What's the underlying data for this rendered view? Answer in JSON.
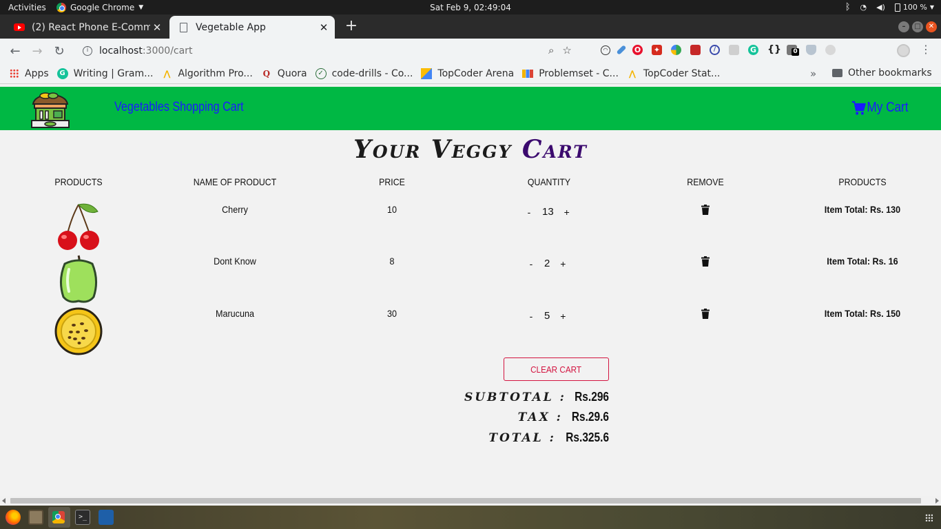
{
  "system_panel": {
    "activities": "Activities",
    "app_name": "Google Chrome",
    "clock": "Sat Feb  9, 02:49:04",
    "battery": "100 %"
  },
  "browser": {
    "tabs": [
      {
        "title": "(2) React Phone E-Comme",
        "icon": "youtube-icon"
      },
      {
        "title": "Vegetable App",
        "icon": "page-icon"
      }
    ],
    "url_host": "localhost",
    "url_path": ":3000/cart",
    "ext_badge": "0",
    "bookmarks": [
      {
        "label": "Apps",
        "icon": "apps-grid-icon"
      },
      {
        "label": "Writing | Gram...",
        "icon": "grammarly-icon"
      },
      {
        "label": "Algorithm Pro...",
        "icon": "algorithm-icon"
      },
      {
        "label": "Quora",
        "icon": "quora-icon"
      },
      {
        "label": "code-drills - Co...",
        "icon": "check-icon"
      },
      {
        "label": "TopCoder Arena",
        "icon": "topcoder-icon"
      },
      {
        "label": "Problemset - C...",
        "icon": "bars-icon"
      },
      {
        "label": "TopCoder Stat...",
        "icon": "topcoder-stat-icon"
      }
    ],
    "more_bookmarks": "»",
    "other_bookmarks": "Other bookmarks"
  },
  "app": {
    "brand": "Vegetables Shopping Cart",
    "my_cart": "My Cart",
    "title_main": "Your Veggy ",
    "title_accent": "Cart",
    "columns": [
      "products",
      "name of product",
      "price",
      "quantity",
      "remove",
      "products"
    ],
    "items": [
      {
        "name": "Cherry",
        "price": "10",
        "quantity": "13",
        "total": "Item Total: Rs. 130",
        "image": "cherry"
      },
      {
        "name": "Dont Know",
        "price": "8",
        "quantity": "2",
        "total": "Item Total: Rs. 16",
        "image": "green-pepper"
      },
      {
        "name": "Marucuna",
        "price": "30",
        "quantity": "5",
        "total": "Item Total: Rs. 150",
        "image": "passion-fruit"
      }
    ],
    "decrement": "-",
    "increment": "+",
    "clear_cart": "clear cart",
    "subtotal_label": "subtotal :",
    "subtotal_value": "Rs.296",
    "tax_label": "tax :",
    "tax_value": "Rs.29.6",
    "total_label": "total :",
    "total_value": "Rs.325.6"
  },
  "colors": {
    "navbar": "#00b844",
    "link": "#1a1aff",
    "accent": "#3b0a6e",
    "danger": "#d3133f"
  }
}
